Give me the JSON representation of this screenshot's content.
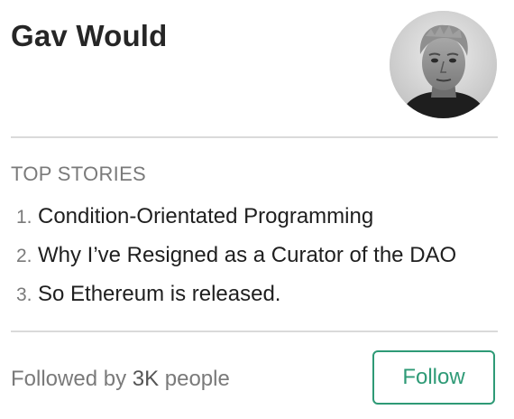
{
  "author": {
    "name": "Gav Would",
    "avatar_icon": "portrait-photo"
  },
  "top_stories": {
    "heading": "TOP STORIES",
    "items": [
      {
        "number": "1.",
        "title": "Condition-Orientated Programming"
      },
      {
        "number": "2.",
        "title": "Why I’ve Resigned as a Curator of the DAO"
      },
      {
        "number": "3.",
        "title": "So Ethereum is released."
      }
    ]
  },
  "footer": {
    "followed_by_prefix": "Followed by",
    "followers_count": "3K",
    "followed_by_suffix": "people",
    "follow_label": "Follow"
  },
  "colors": {
    "accent": "#2e9a76",
    "muted_text": "#7a7a7a",
    "divider": "#dadada"
  }
}
